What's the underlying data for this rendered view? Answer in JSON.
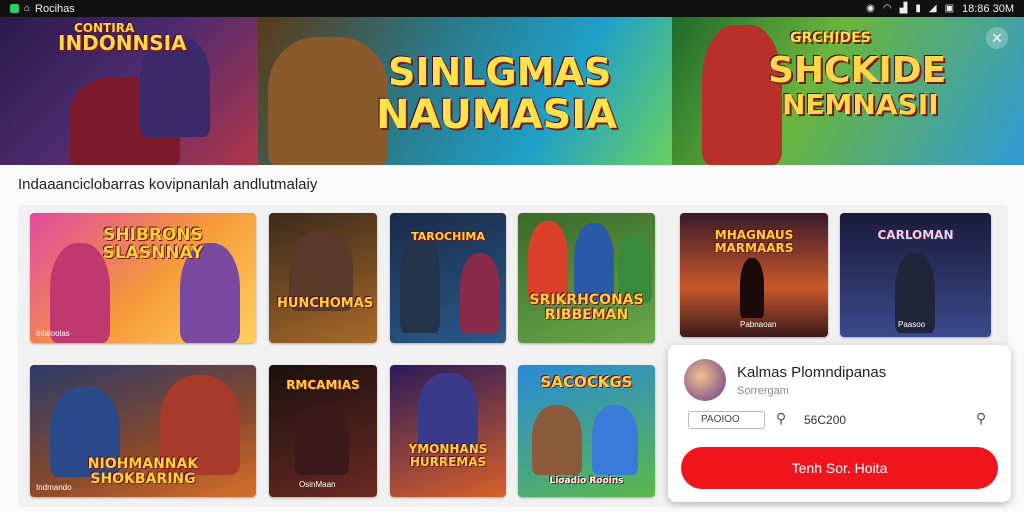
{
  "status_bar": {
    "app_name": "Rocihas",
    "time": "18:86 30M",
    "icons": [
      "app-icon",
      "location-icon",
      "wifi-icon",
      "signal-icon",
      "sync-icon",
      "battery-icon",
      "image-icon"
    ]
  },
  "banner": {
    "panel1_title": "INDONNSIA",
    "panel1_subtitle": "CONTIRA",
    "panel2_title_line1": "SINLGMAS",
    "panel2_title_line2": "NAUMASIA",
    "panel3_title_line1": "GRCHIDES",
    "panel3_title_line2": "SHCKIDE",
    "panel3_title_line3": "NEMNASII"
  },
  "section_title": "Indaaanciclobarras kovipnanlah andlutmalaiy",
  "games": [
    {
      "title": "SHIBRONS SLASNNAY",
      "caption": "Inlaloolas"
    },
    {
      "title": "HUNCHOMAS",
      "caption": ""
    },
    {
      "title": "TAROCHIMA",
      "caption": ""
    },
    {
      "title": "SRIKRHCONAS RIBBEMAN",
      "caption": ""
    },
    {
      "title": "MHAGNAUS MARMAARS",
      "caption": "Pabnaoan"
    },
    {
      "title": "CARLOMAN",
      "caption": "Paasoo"
    },
    {
      "title": "NIOHMANNAK SHOKBARING",
      "caption": "Indmando"
    },
    {
      "title": "RMCAMIAS",
      "caption": "OsinMaan"
    },
    {
      "title": "YMONHANS HURREMAS",
      "caption": ""
    },
    {
      "title": "SACOCKGS",
      "caption": "Lioadio Rooins"
    }
  ],
  "popup": {
    "title": "Kalmas Plomndipanas",
    "subtitle": "Sorrergam",
    "field_value": "PAOIOO",
    "value": "56C200",
    "button_label": "Tenh Sor. Hoita"
  },
  "colors": {
    "accent": "#f0141c",
    "statusbar": "#111111"
  }
}
